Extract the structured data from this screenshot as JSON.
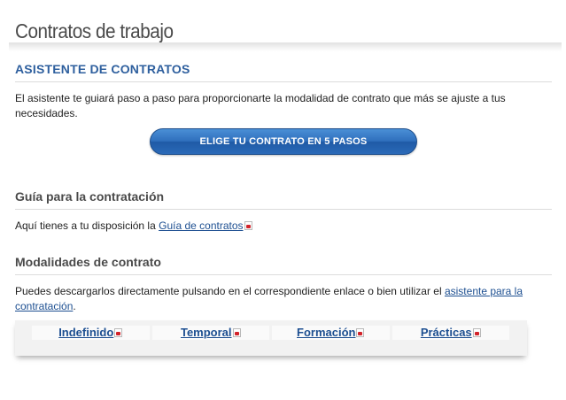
{
  "page": {
    "title": "Contratos de trabajo"
  },
  "wizard": {
    "heading": "ASISTENTE DE CONTRATOS",
    "description": "El asistente te guiará paso a paso para proporcionarte la modalidad de contrato que más se ajuste a tus necesidades.",
    "button_label": "ELIGE TU CONTRATO EN 5 PASOS"
  },
  "guide": {
    "heading": "Guía para la contratación",
    "text_prefix": "Aquí tienes a tu disposición la ",
    "link_label": "Guía de contratos",
    "icon": "pdf-icon"
  },
  "modalities": {
    "heading": "Modalidades de contrato",
    "text_prefix": "Puedes descargarlos directamente pulsando en el correspondiente enlace o bien utilizar el ",
    "link_label": "asistente para la contratación",
    "text_suffix": ".",
    "items": [
      {
        "label": "Indefinido",
        "icon": "pdf-icon"
      },
      {
        "label": "Temporal",
        "icon": "pdf-icon"
      },
      {
        "label": "Formación",
        "icon": "pdf-icon"
      },
      {
        "label": "Prácticas",
        "icon": "pdf-icon"
      }
    ]
  },
  "colors": {
    "heading_blue": "#2e5f9e",
    "link_blue": "#1d4f91",
    "button_blue": "#2f6fbc",
    "pdf_red": "#d2232a"
  }
}
